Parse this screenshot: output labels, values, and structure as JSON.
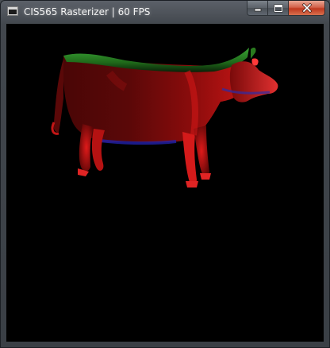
{
  "window": {
    "title": "CIS565 Rasterizer | 60 FPS",
    "icon": "app-window-icon"
  },
  "caption_buttons": {
    "minimize_icon": "minimize-icon",
    "maximize_icon": "maximize-icon",
    "close_icon": "close-icon"
  },
  "viewport": {
    "background": "#000000",
    "model": "cow",
    "shading_colors": {
      "normal_x": "#ff0000",
      "normal_y": "#00c000",
      "normal_z": "#3030ff"
    }
  }
}
